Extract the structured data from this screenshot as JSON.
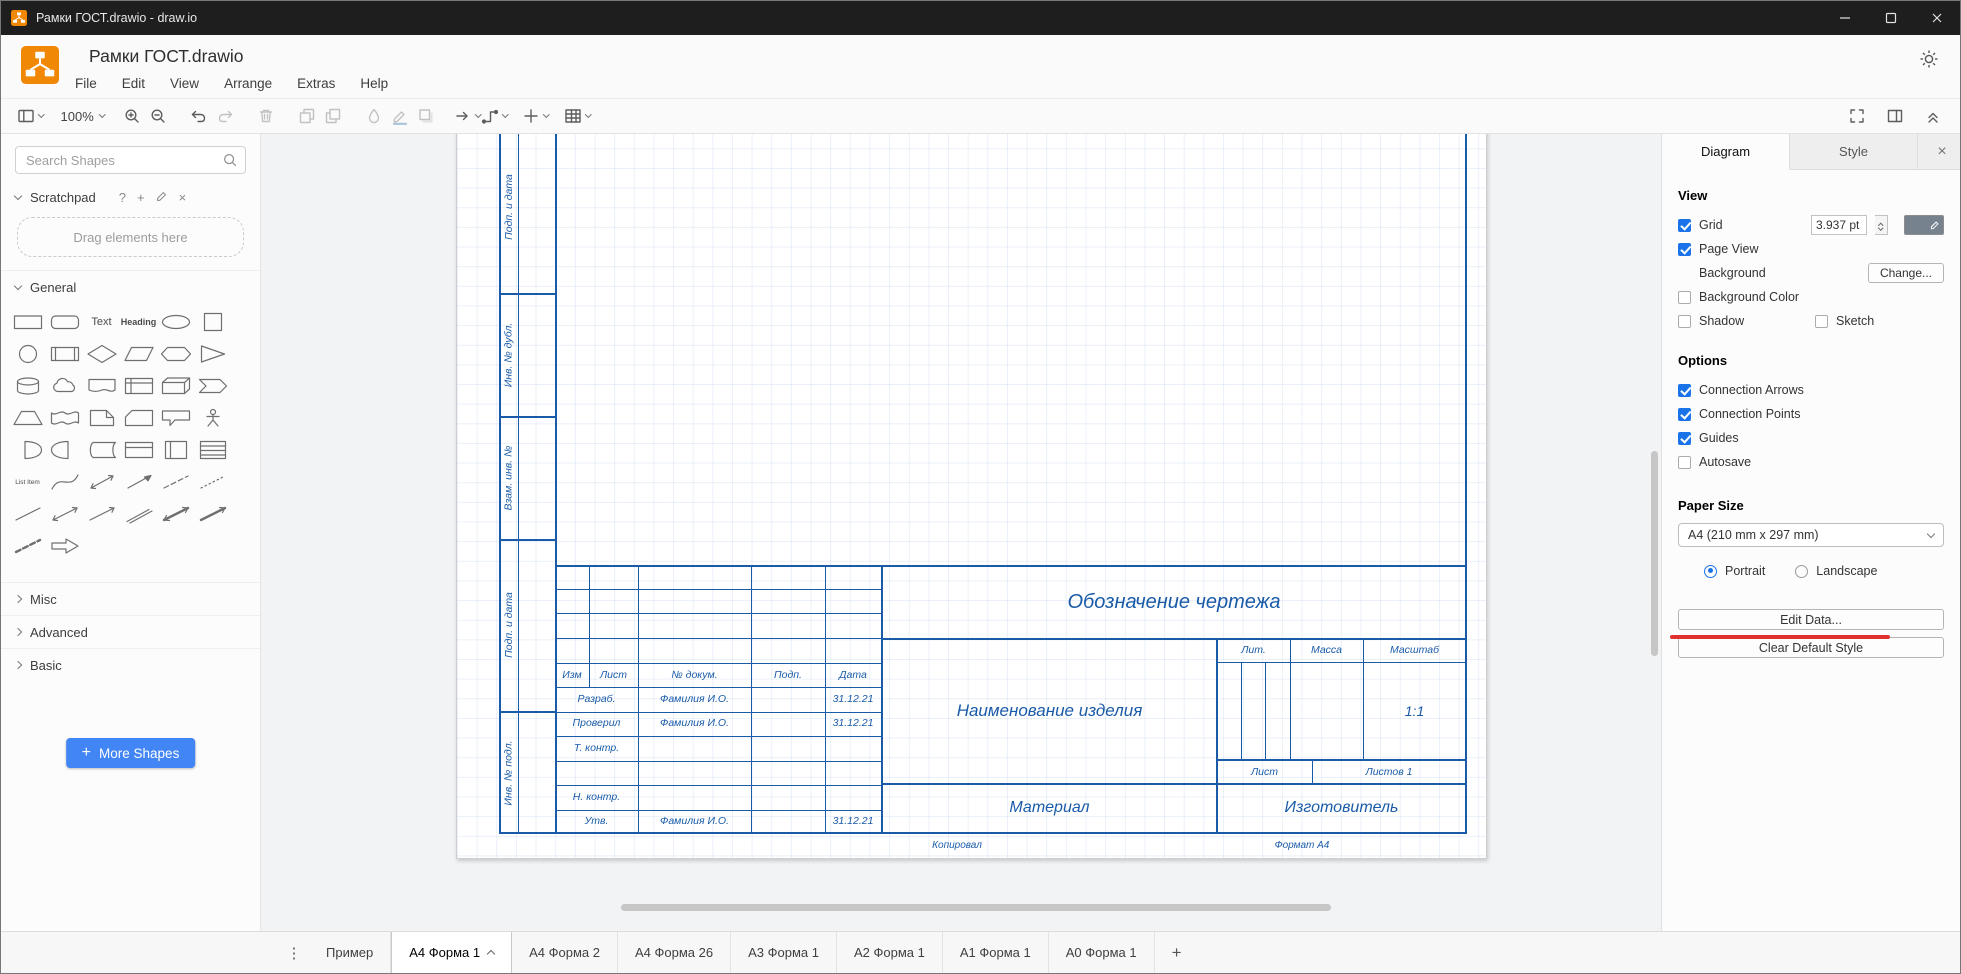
{
  "window": {
    "title": "Рамки ГОСТ.drawio - draw.io"
  },
  "header": {
    "doc_title": "Рамки ГОСТ.drawio",
    "menus": [
      "File",
      "Edit",
      "View",
      "Arrange",
      "Extras",
      "Help"
    ]
  },
  "toolbar": {
    "zoom": "100%"
  },
  "sidebar": {
    "search_placeholder": "Search Shapes",
    "scratchpad": {
      "title": "Scratchpad",
      "hint": "Drag elements here"
    },
    "sections": [
      {
        "label": "General",
        "expanded": true
      },
      {
        "label": "Misc",
        "expanded": false
      },
      {
        "label": "Advanced",
        "expanded": false
      },
      {
        "label": "Basic",
        "expanded": false
      }
    ],
    "previews": {
      "text": "Text",
      "textbox": "Heading",
      "list_item": "List Item"
    },
    "shape_names": [
      "rectangle",
      "rounded-rectangle",
      "text",
      "textbox",
      "ellipse",
      "square",
      "circle",
      "process",
      "diamond",
      "parallelogram",
      "hexagon",
      "triangle",
      "cylinder",
      "cloud",
      "document",
      "internal-storage",
      "cube",
      "step",
      "trapezoid",
      "tape",
      "note",
      "card",
      "callout",
      "actor",
      "or",
      "and",
      "data-storage",
      "container",
      "vertical-container",
      "list",
      "list-item",
      "curve",
      "bidirectional-arrow",
      "arrow",
      "dashed-line",
      "dotted-line",
      "line",
      "bidirectional-connector",
      "directional-connector",
      "link",
      "bidirectional-link",
      "directional-link",
      "dashed-link",
      "thick-arrow"
    ],
    "more_shapes_label": "More Shapes"
  },
  "canvas": {
    "margin_labels": [
      "Подп. и дата",
      "Инв. № дубл.",
      "Взам. инв. №",
      "Подп. и дата",
      "Инв. № подл."
    ],
    "title_block": {
      "designation": "Обозначение чертежа",
      "product_name": "Наименование изделия",
      "material": "Материал",
      "manufacturer": "Изготовитель",
      "columns": [
        "Изм",
        "Лист",
        "№ докум.",
        "Подп.",
        "Дата"
      ],
      "rows": [
        {
          "role": "Разраб.",
          "name": "Фамилия И.О.",
          "date": "31.12.21"
        },
        {
          "role": "Проверил",
          "name": "Фамилия И.О.",
          "date": "31.12.21"
        },
        {
          "role": "Т. контр.",
          "name": "",
          "date": ""
        },
        {
          "role": "",
          "name": "",
          "date": ""
        },
        {
          "role": "Н. контр.",
          "name": "",
          "date": ""
        },
        {
          "role": "Утв.",
          "name": "Фамилия И.О.",
          "date": "31.12.21"
        }
      ],
      "lit_label": "Лит.",
      "mass_label": "Масса",
      "scale_label": "Масштаб",
      "scale_value": "1:1",
      "sheet_label": "Лист",
      "sheets_label": "Листов 1",
      "copied_label": "Копировал",
      "format_label": "Формат А4"
    }
  },
  "format_panel": {
    "tabs": [
      "Diagram",
      "Style"
    ],
    "view": {
      "heading": "View",
      "grid_label": "Grid",
      "grid_checked": true,
      "grid_size": "3.937 pt",
      "page_view_label": "Page View",
      "page_view_checked": true,
      "background_label": "Background",
      "change_button": "Change...",
      "background_color_label": "Background Color",
      "background_color_checked": false,
      "shadow_label": "Shadow",
      "shadow_checked": false,
      "sketch_label": "Sketch",
      "sketch_checked": false
    },
    "options": {
      "heading": "Options",
      "items": [
        {
          "label": "Connection Arrows",
          "checked": true
        },
        {
          "label": "Connection Points",
          "checked": true
        },
        {
          "label": "Guides",
          "checked": true
        },
        {
          "label": "Autosave",
          "checked": false
        }
      ]
    },
    "paper": {
      "heading": "Paper Size",
      "size_value": "A4 (210 mm x 297 mm)",
      "portrait_label": "Portrait",
      "landscape_label": "Landscape",
      "orientation": "portrait"
    },
    "buttons": {
      "edit_data": "Edit Data...",
      "clear_default_style": "Clear Default Style"
    }
  },
  "footer": {
    "pages": [
      {
        "label": "Пример",
        "active": false
      },
      {
        "label": "А4 Форма 1",
        "active": true
      },
      {
        "label": "А4 Форма 2",
        "active": false
      },
      {
        "label": "А4 Форма 26",
        "active": false
      },
      {
        "label": "А3 Форма 1",
        "active": false
      },
      {
        "label": "А2 Форма 1",
        "active": false
      },
      {
        "label": "А1 Форма 1",
        "active": false
      },
      {
        "label": "А0 Форма 1",
        "active": false
      }
    ],
    "add_page_label": "+"
  },
  "colors": {
    "drawing_blue": "#1a5ba8",
    "accent_blue": "#1a73e8",
    "logo_orange": "#F08705",
    "annotation_red": "#e03131",
    "more_shapes_blue": "#4285f4"
  }
}
